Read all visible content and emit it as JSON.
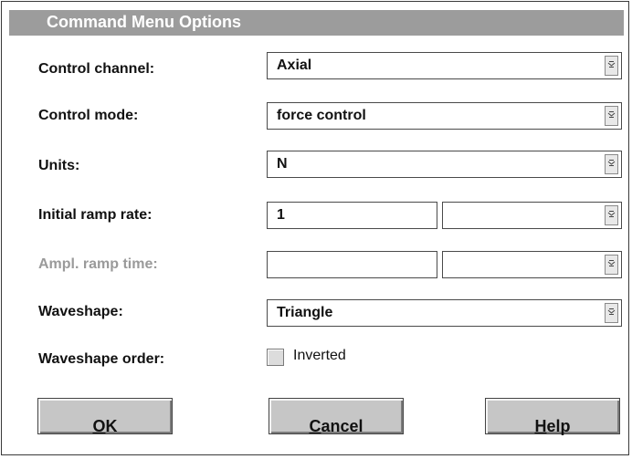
{
  "dialog": {
    "title": "Command Menu Options"
  },
  "fields": {
    "control_channel": {
      "label": "Control channel:",
      "value": "Axial"
    },
    "control_mode": {
      "label": "Control mode:",
      "value": "force control"
    },
    "units": {
      "label": "Units:",
      "value": "N"
    },
    "initial_ramp_rate": {
      "label": "Initial ramp rate:",
      "value": "1",
      "unit_value": ""
    },
    "ampl_ramp_time": {
      "label": "Ampl. ramp time:",
      "value": "",
      "unit_value": ""
    },
    "waveshape": {
      "label": "Waveshape:",
      "value": "Triangle"
    },
    "waveshape_order": {
      "label": "Waveshape order:",
      "checkbox_label": "Inverted",
      "checked": false
    }
  },
  "buttons": {
    "ok": {
      "mnemonic": "O",
      "rest": "K"
    },
    "cancel": {
      "mnemonic": "C",
      "rest": "ancel"
    },
    "help": {
      "mnemonic": "H",
      "rest": "elp"
    }
  }
}
